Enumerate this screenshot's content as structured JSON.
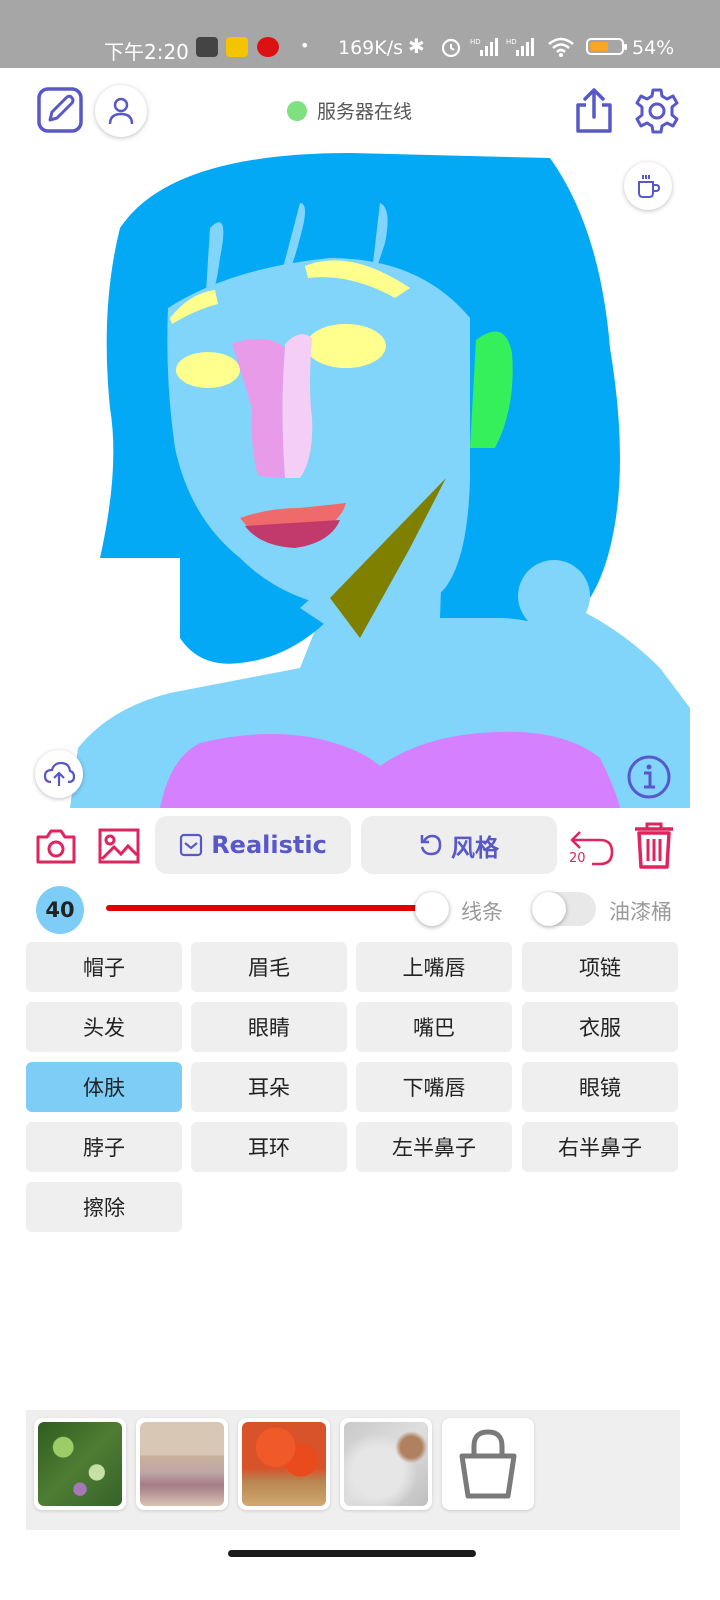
{
  "status_bar": {
    "time": "下午2:20",
    "net_speed": "169K/s",
    "battery_pct": "54%",
    "icons": [
      "news-app-icon",
      "weather-app-icon",
      "bank-app-icon",
      "bluetooth-icon",
      "alarm-icon",
      "signal-hd-icon",
      "signal-hd-icon",
      "wifi-icon",
      "battery-icon"
    ]
  },
  "top_bar": {
    "server_status": "服务器在线",
    "server_status_color": "#7ee07e",
    "icons": [
      "edit-icon",
      "user-icon",
      "share-icon",
      "settings-icon"
    ]
  },
  "canvas": {
    "overlay_icons": [
      "coffee-icon",
      "upload-cloud-icon",
      "info-icon"
    ]
  },
  "toolbar": {
    "style_label": "Realistic",
    "reroll_label": "风格",
    "undo_count": "20",
    "icons": [
      "camera-icon",
      "image-icon",
      "checkbox-icon",
      "refresh-icon",
      "undo-icon",
      "trash-icon"
    ]
  },
  "brush": {
    "size": "40",
    "size_fraction": 0.92,
    "line_label": "线条",
    "bucket_label": "油漆桶",
    "bucket_enabled": false,
    "color": "#e00000"
  },
  "categories": [
    {
      "label": "帽子"
    },
    {
      "label": "眉毛"
    },
    {
      "label": "上嘴唇"
    },
    {
      "label": "项链"
    },
    {
      "label": "头发"
    },
    {
      "label": "眼睛"
    },
    {
      "label": "嘴巴"
    },
    {
      "label": "衣服"
    },
    {
      "label": "体肤"
    },
    {
      "label": "耳朵"
    },
    {
      "label": "下嘴唇"
    },
    {
      "label": "眼镜"
    },
    {
      "label": "脖子"
    },
    {
      "label": "耳环"
    },
    {
      "label": "左半鼻子"
    },
    {
      "label": "右半鼻子"
    },
    {
      "label": "擦除"
    }
  ],
  "selected_category": "体肤",
  "style_thumbnails": [
    "style-1",
    "style-2",
    "style-3",
    "style-4"
  ],
  "colors": {
    "accent": "#5858c8",
    "danger": "#e0245e",
    "selected": "#7dcdf7",
    "hair": "#03a9f4",
    "skin": "#81d4fa",
    "clothes": "#d580ff"
  }
}
